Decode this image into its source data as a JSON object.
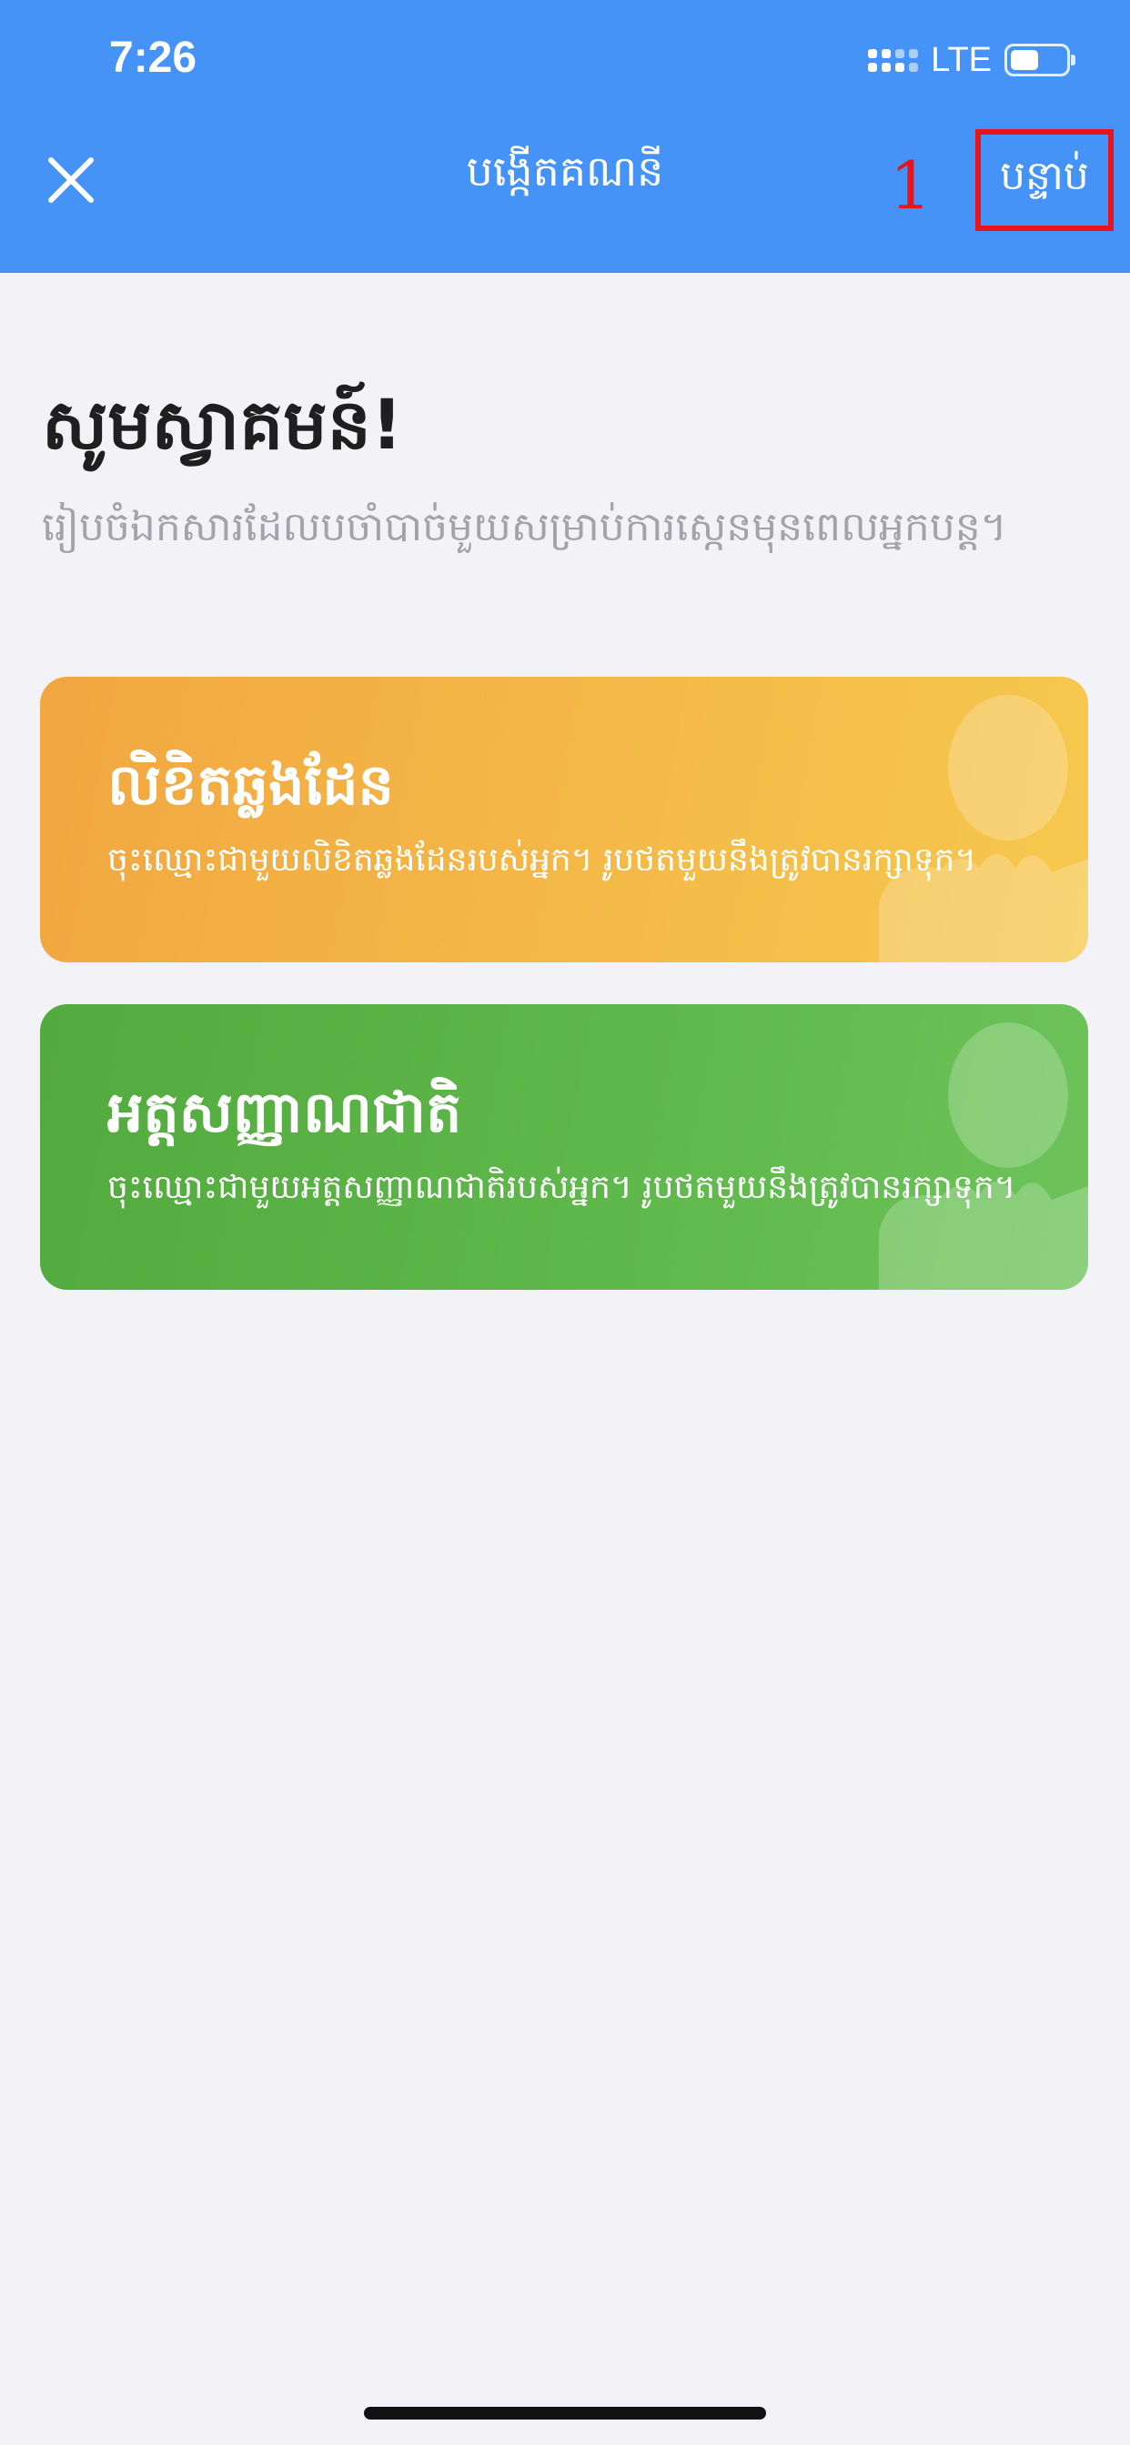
{
  "status_bar": {
    "time": "7:26",
    "network": "LTE",
    "icons": [
      "signal-icon",
      "battery-icon"
    ]
  },
  "nav": {
    "close_icon": "close-icon",
    "title": "បង្កើតគណនី",
    "annotation_number": "1",
    "next_label": "បន្ទាប់",
    "annotation_color": "#e8141c",
    "header_color": "#4593f7"
  },
  "welcome": {
    "title": "សូមស្វាគមន៍!",
    "subtitle": "រៀបចំឯកសារដែលបចាំបាច់មួយសម្រាប់ការស្កេនមុនពេលអ្នកបន្ត។"
  },
  "documents": [
    {
      "title": "លិខិតឆ្លងដែន",
      "description": "ចុះឈ្មោះជាមួយលិខិតឆ្លងដែនរបស់អ្នក។ រូបថតមួយនឹងត្រូវបានរក្សាទុក។",
      "color": "#f4b446"
    },
    {
      "title": "អត្តសញ្ញាណជាតិ",
      "description": "ចុះឈ្មោះជាមួយអត្តសញ្ញាណជាតិរបស់អ្នក។ រូបថតមួយនឹងត្រូវបានរក្សាទុក។",
      "color": "#5db548"
    }
  ]
}
